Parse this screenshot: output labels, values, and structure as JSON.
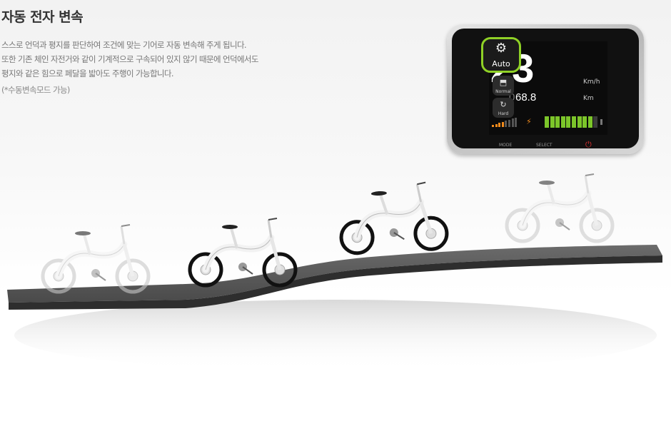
{
  "title": "자동 전자 변속",
  "description": [
    "스스로 언덕과 평지를 판단하여 조건에 맞는 기어로 자동 변속해 주게 됩니다.",
    "또한 기존 체인 자전거와 같이 기계적으로 구속되어 있지 않기 때문에 언덕에서도",
    "평지와 같은 힘으로 페달을 밟아도 주행이 가능합니다."
  ],
  "note": "(*수동변속모드 가능)",
  "display": {
    "modes": {
      "auto": "Auto",
      "normal": "Normal",
      "hard": "Hard"
    },
    "speed": "23",
    "speed_unit": "Km/h",
    "odometer_lead": "0",
    "odometer": "68.8",
    "odometer_unit": "Km",
    "buttons": {
      "mode": "MODE",
      "select": "SELECT",
      "power": "⏻"
    },
    "battery_cells_filled": 9,
    "battery_cells_total": 10,
    "assist_bars_lit": 4,
    "assist_bars_total": 8,
    "colors": {
      "auto_highlight": "#8fd126",
      "battery": "#7cc52a",
      "assist": "#f08a1c",
      "power": "#e03030"
    }
  },
  "icons": {
    "auto": "gear-icon",
    "normal": "normal-mode-icon",
    "hard": "hard-mode-icon",
    "bolt": "bolt-icon",
    "power": "power-icon"
  }
}
